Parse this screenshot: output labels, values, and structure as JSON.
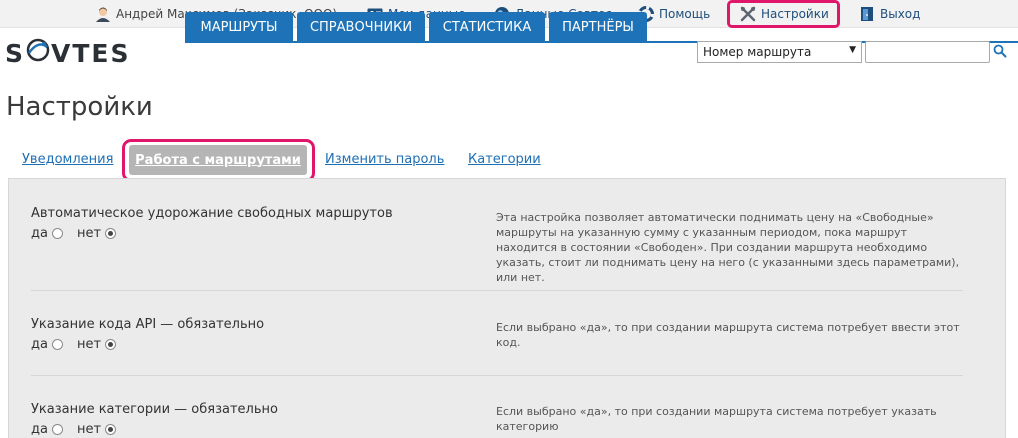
{
  "topbar": {
    "user": "Андрей Максимов (Заказчик, ООО)",
    "profile": "Мои данные",
    "sovtes": "Данные Совтес",
    "help": "Помощь",
    "settings": "Настройки",
    "logout": "Выход"
  },
  "logo": {
    "left": "S",
    "right": "VTES"
  },
  "nav": {
    "tabs": [
      "МАРШРУТЫ",
      "СПРАВОЧНИКИ",
      "СТАТИСТИКА",
      "ПАРТНЁРЫ"
    ]
  },
  "search": {
    "select_value": "Номер маршрута",
    "input_value": ""
  },
  "page": {
    "title": "Настройки"
  },
  "subtabs": {
    "notifications": "Уведомления",
    "routes_work": "Работа с маршрутами",
    "change_password": "Изменить пароль",
    "categories": "Категории"
  },
  "settings": [
    {
      "title": "Автоматическое удорожание свободных маршрутов",
      "yes": "да",
      "no": "нет",
      "selected": "нет",
      "description": "Эта настройка позволяет автоматически поднимать цену на «Свободные» маршруты на указанную сумму с указанным периодом, пока маршрут находится в состоянии «Свободен». При создании маршрута необходимо указать, стоит ли поднимать цену на него (с указанными здесь параметрами), или нет."
    },
    {
      "title": "Указание кода API — обязательно",
      "yes": "да",
      "no": "нет",
      "selected": "нет",
      "description": "Если выбрано «да», то при создании маршрута система потребует ввести этот код."
    },
    {
      "title": "Указание категории — обязательно",
      "yes": "да",
      "no": "нет",
      "selected": "нет",
      "description": "Если выбрано «да», то при создании маршрута система потребует указать категорию"
    }
  ],
  "colors": {
    "accent": "#1e73b8",
    "highlight": "#e0166a",
    "active_tab": "#b5b5b5"
  }
}
